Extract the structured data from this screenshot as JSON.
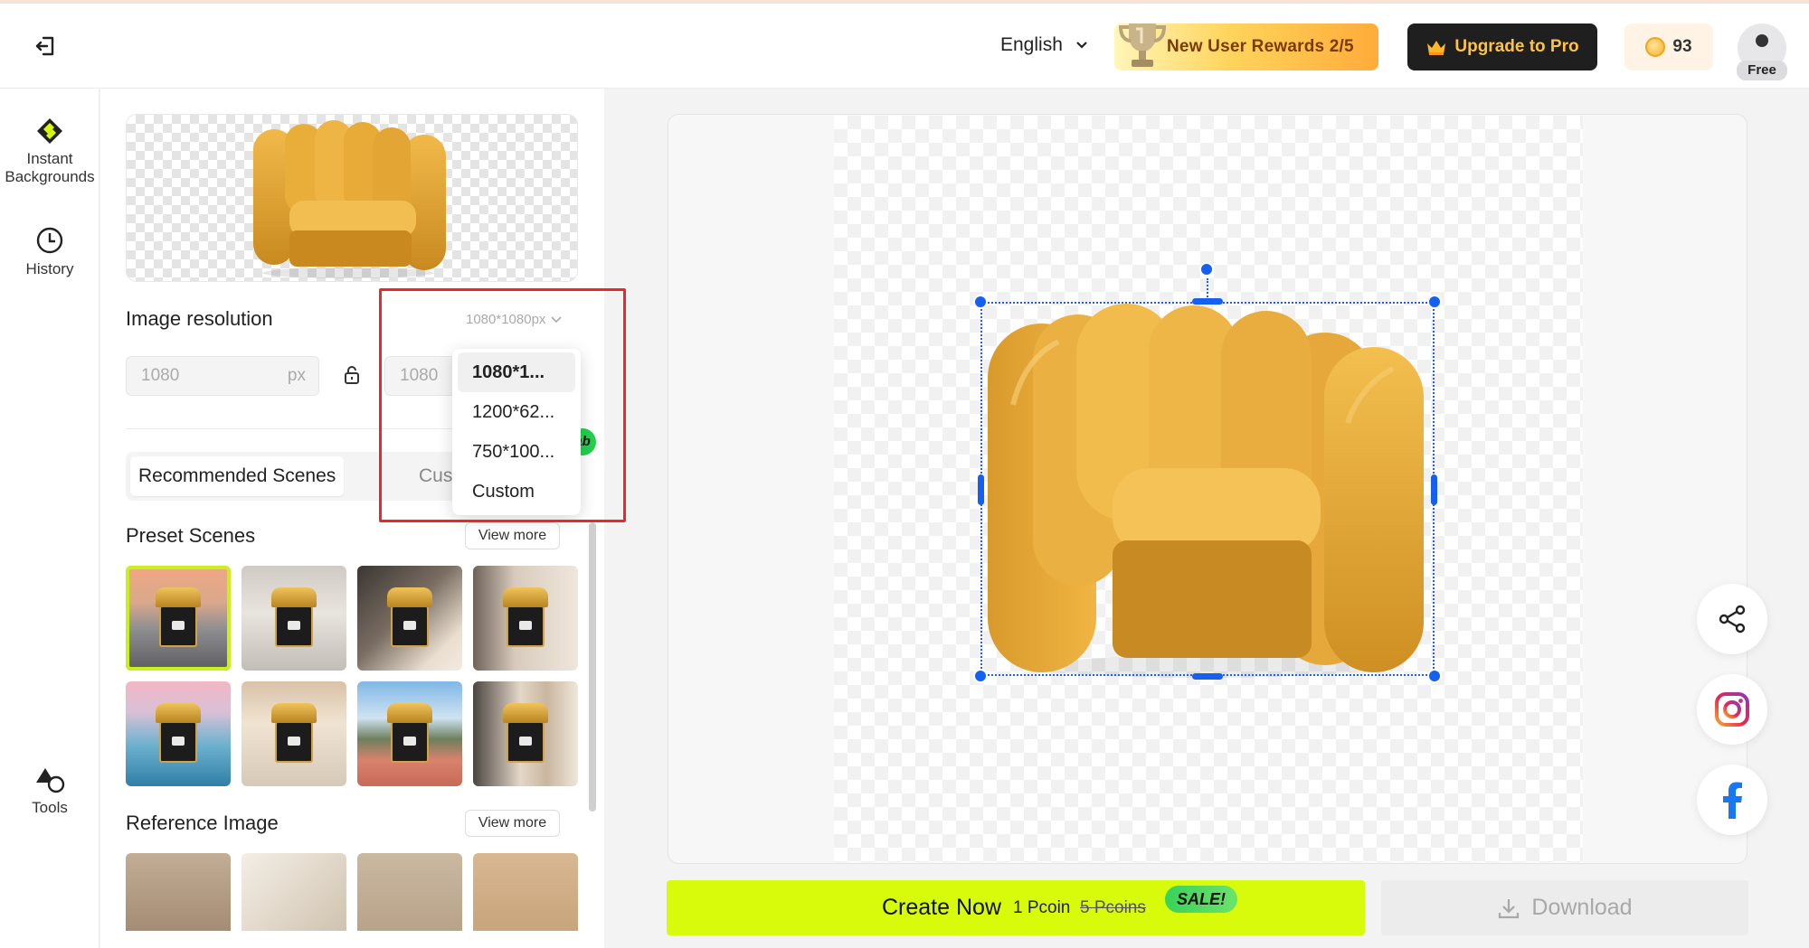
{
  "topbar": {
    "language": "English",
    "rewards_label": "New User Rewards 2/5",
    "upgrade_label": "Upgrade to Pro",
    "coins": "93",
    "plan_badge": "Free"
  },
  "rail": {
    "instant_backgrounds_line1": "Instant",
    "instant_backgrounds_line2": "Backgrounds",
    "history": "History",
    "tools": "Tools"
  },
  "panel": {
    "resolution_title": "Image resolution",
    "resolution_value": "1080*1080px",
    "width_value": "1080",
    "width_unit": "px",
    "height_value": "1080",
    "tabs": [
      "Recommended Scenes",
      "Custor"
    ],
    "lab_badge": "ab",
    "preset_title": "Preset Scenes",
    "reference_title": "Reference Image",
    "view_more": "View more"
  },
  "dropdown": {
    "options": [
      "1080*1...",
      "1200*62...",
      "750*100...",
      "Custom"
    ],
    "selected_index": 0
  },
  "actions": {
    "create_label": "Create Now",
    "cost": "1 Pcoin",
    "old_cost": "5 Pcoins",
    "sale": "SALE!",
    "download": "Download"
  },
  "colors": {
    "accent_lime": "#d7fb0b",
    "selection_blue": "#1560f0",
    "highlight_red": "#e8282c",
    "pro_gold": "#ffc341"
  },
  "icons": {
    "exit": "exit-icon",
    "chevron": "chevron-down-icon",
    "trophy": "trophy-icon",
    "crown": "crown-icon",
    "coin": "coin-icon",
    "history": "clock-icon",
    "tools": "shapes-icon",
    "lock": "lock-icon",
    "share": "share-icon",
    "instagram": "instagram-icon",
    "facebook": "facebook-icon",
    "download": "download-icon"
  }
}
